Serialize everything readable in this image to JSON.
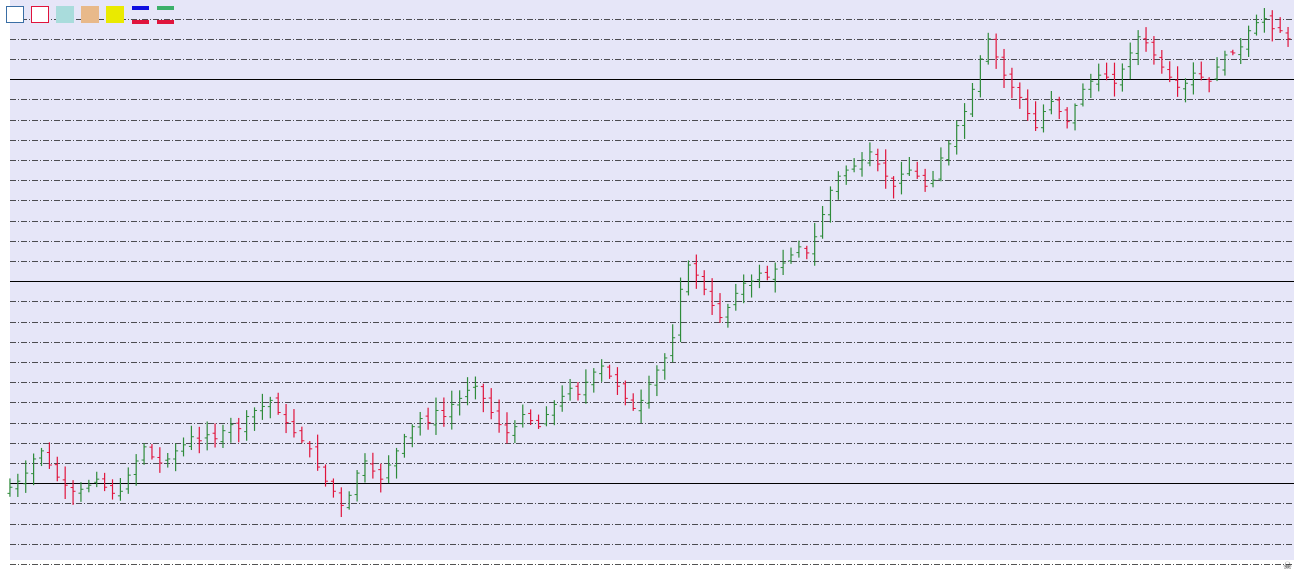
{
  "colors": {
    "plot_background": "#e6e6f8",
    "page_background": "#ffffff",
    "gridline_dashed": "#1a1a1a",
    "gridline_solid": "#000000",
    "bull_candle": "#2e8b3a",
    "bear_candle": "#e0143c"
  },
  "toolbar": {
    "swatches": [
      {
        "name": "white-rect-tool",
        "fill": "#ffffff",
        "border": "#3a6ea5"
      },
      {
        "name": "red-outline-rect-tool",
        "fill": "#ffffff",
        "border": "#e0143c"
      },
      {
        "name": "teal-rect-tool",
        "fill": "#a9dcdc",
        "border": "#a9dcdc"
      },
      {
        "name": "orange-rect-tool",
        "fill": "#e8b98a",
        "border": "#e8b98a"
      },
      {
        "name": "yellow-rect-tool",
        "fill": "#eaea00",
        "border": "#eaea00"
      }
    ],
    "lines": [
      {
        "name": "blue-line-tool",
        "color": "#1010e0"
      },
      {
        "name": "green-line-tool",
        "color": "#3cb06a"
      },
      {
        "name": "red-line-tool-1",
        "color": "#e0143c"
      },
      {
        "name": "red-line-tool-2",
        "color": "#e0143c"
      }
    ]
  },
  "corner_icon": "skull-icon",
  "chart_data": {
    "type": "candlestick",
    "title": "",
    "xlabel": "",
    "ylabel": "",
    "ylim": [
      0,
      27
    ],
    "grid": true,
    "solid_levels": [
      4,
      14,
      24
    ],
    "close": [
      3.8,
      4.1,
      4.5,
      5.2,
      5.6,
      4.9,
      4.3,
      3.9,
      3.6,
      3.7,
      3.9,
      4.2,
      3.8,
      3.5,
      3.6,
      4.4,
      5.1,
      5.8,
      5.3,
      5.0,
      5.2,
      5.6,
      5.9,
      6.3,
      6.1,
      6.4,
      6.2,
      6.6,
      6.9,
      6.7,
      7.3,
      7.6,
      7.8,
      8.1,
      7.5,
      7.0,
      6.5,
      6.1,
      5.7,
      4.8,
      4.1,
      3.6,
      2.9,
      3.4,
      4.5,
      5.1,
      4.6,
      4.2,
      4.9,
      5.6,
      6.3,
      6.8,
      7.2,
      7.0,
      7.6,
      7.3,
      7.9,
      8.2,
      8.6,
      8.8,
      8.2,
      7.5,
      6.9,
      6.5,
      6.8,
      7.4,
      7.1,
      6.8,
      7.4,
      7.9,
      8.3,
      8.7,
      8.4,
      9.0,
      9.5,
      9.8,
      9.3,
      8.8,
      8.2,
      7.7,
      8.1,
      8.9,
      9.6,
      10.2,
      11.2,
      13.6,
      14.8,
      14.3,
      13.6,
      12.8,
      12.2,
      12.7,
      13.4,
      13.9,
      14.0,
      14.4,
      14.2,
      14.6,
      14.9,
      15.3,
      15.7,
      15.4,
      16.2,
      17.3,
      18.5,
      19.2,
      19.5,
      19.7,
      20.0,
      20.4,
      19.8,
      19.2,
      18.7,
      19.3,
      19.5,
      19.2,
      18.7,
      19.0,
      20.1,
      20.8,
      21.7,
      22.4,
      23.5,
      25.0,
      26.0,
      25.1,
      24.2,
      23.6,
      23.1,
      22.3,
      21.6,
      22.4,
      22.9,
      22.4,
      21.9,
      22.7,
      23.5,
      23.9,
      24.2,
      24.1,
      23.8,
      24.5,
      25.3,
      26.1,
      25.8,
      25.2,
      24.6,
      24.1,
      23.6,
      23.8,
      24.3,
      24.1,
      23.9,
      24.6,
      25.2,
      25.3,
      25.6,
      26.4,
      26.8,
      27.0,
      26.5,
      26.4,
      26.0
    ]
  }
}
